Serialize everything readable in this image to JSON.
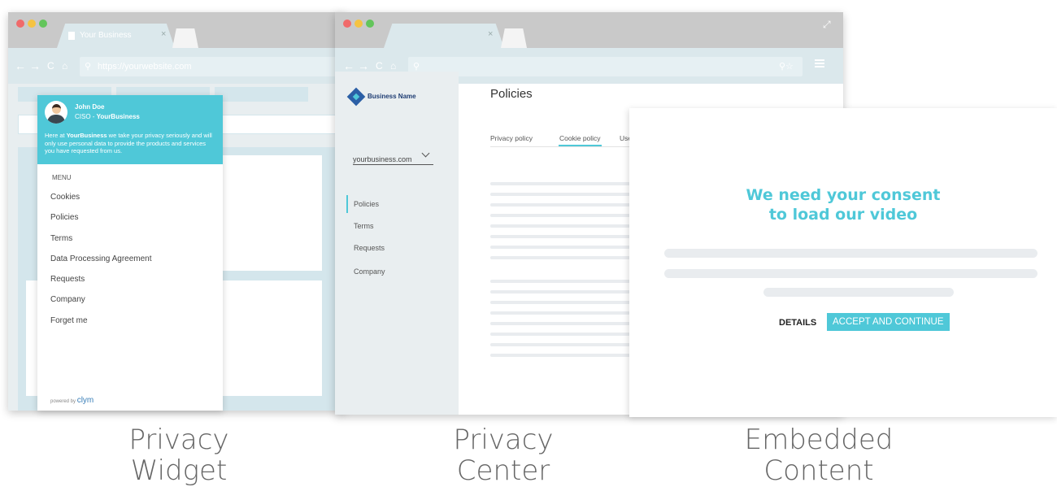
{
  "widget_window": {
    "tab_title": "Your Business",
    "url": "https://yourwebsite.com",
    "profile": {
      "name": "John Doe",
      "role_prefix": "CISO - ",
      "role_company": "YourBusiness",
      "intro_1": "Here at ",
      "intro_brand": "YourBusiness",
      "intro_2": " we take your privacy seriously and will only use personal data to provide the products and services you have requested from us."
    },
    "menu_heading": "MENU",
    "menu_items": [
      "Cookies",
      "Policies",
      "Terms",
      "Data Processing Agreement",
      "Requests",
      "Company",
      "Forget me"
    ],
    "powered_by": "powered by",
    "powered_brand": "clym"
  },
  "center_window": {
    "brand_name": "Business Name",
    "domain_select": "yourbusiness.com",
    "nav_items": [
      "Policies",
      "Terms",
      "Requests",
      "Company"
    ],
    "active_nav": "Policies",
    "page_title": "Policies",
    "tabs": [
      "Privacy policy",
      "Cookie policy",
      "Use"
    ],
    "active_tab": "Cookie policy"
  },
  "consent_panel": {
    "heading_line1": "We need your consent",
    "heading_line2": "to load our video",
    "details_label": "DETAILS",
    "accept_label": "ACCEPT AND CONTINUE"
  },
  "captions": {
    "widget_line1": "Privacy",
    "widget_line2": "Widget",
    "center_line1": "Privacy",
    "center_line2": "Center",
    "embed_line1": "Embedded",
    "embed_line2": "Content"
  },
  "colors": {
    "accent": "#4fc8d8",
    "widget_header": "#4fc8d8",
    "browser_chrome": "#c9c9c9",
    "address_bar": "#dbe8ec",
    "page_bg_light": "#e8eef0",
    "brand_blue": "#2b5fa6"
  },
  "icons": {
    "back": "arrow-left-icon",
    "forward": "arrow-right-icon",
    "reload": "reload-icon",
    "home": "home-icon",
    "search": "search-icon",
    "expand": "expand-icon",
    "menu": "hamburger-icon",
    "dropdown": "chevron-down-icon",
    "avatar": "user-avatar-icon",
    "logo": "business-logo-icon"
  }
}
